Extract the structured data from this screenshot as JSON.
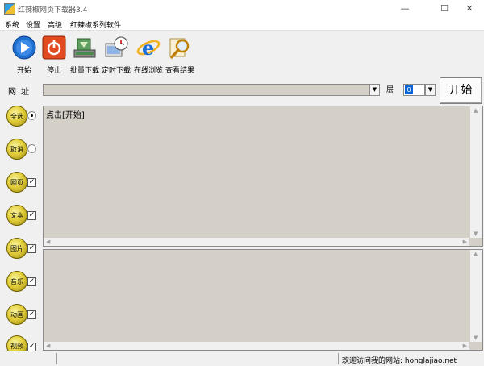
{
  "window": {
    "title": "红辣椒网页下载器3.4",
    "minimize": "—",
    "maximize": "☐",
    "close": "✕"
  },
  "menu": [
    "系统",
    "设置",
    "高级",
    "红辣椒系列软件"
  ],
  "toolbar": [
    {
      "label": "开始",
      "icon": "play-icon"
    },
    {
      "label": "停止",
      "icon": "stop-icon"
    },
    {
      "label": "批量下载",
      "icon": "batch-download-icon"
    },
    {
      "label": "定时下载",
      "icon": "scheduled-download-icon"
    },
    {
      "label": "在线浏览",
      "icon": "ie-browser-icon"
    },
    {
      "label": "查看结果",
      "icon": "view-results-icon"
    }
  ],
  "address": {
    "label": "网址",
    "value": "",
    "layer_label": "层",
    "layer_value": "0",
    "start_label": "开始"
  },
  "side_options": [
    {
      "label": "全选",
      "control": "radio",
      "checked": true
    },
    {
      "label": "取消",
      "control": "radio",
      "checked": false
    },
    {
      "label": "网页",
      "control": "checkbox",
      "checked": true
    },
    {
      "label": "文本",
      "control": "checkbox",
      "checked": true
    },
    {
      "label": "图片",
      "control": "checkbox",
      "checked": true
    },
    {
      "label": "音乐",
      "control": "checkbox",
      "checked": true
    },
    {
      "label": "动画",
      "control": "checkbox",
      "checked": true
    },
    {
      "label": "视频",
      "control": "checkbox",
      "checked": true
    }
  ],
  "main_panel": {
    "text": "点击[开始]"
  },
  "status": {
    "text": "欢迎访问我的网站: honglajiao.net"
  }
}
